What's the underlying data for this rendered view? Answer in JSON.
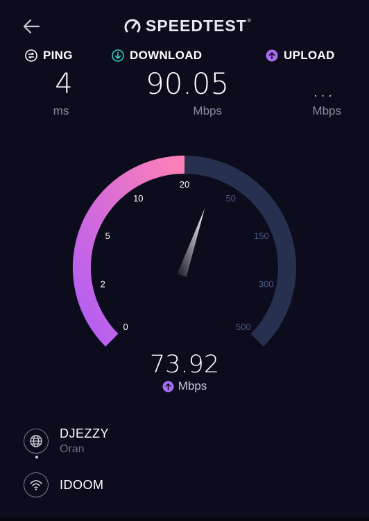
{
  "header": {
    "back_icon": "arrow-left-icon",
    "logo_icon": "speedometer-icon",
    "logo_text": "SPEEDTEST",
    "logo_tm": "®"
  },
  "metrics": {
    "ping": {
      "label": "PING",
      "value": "4",
      "unit": "ms",
      "icon": "ping-icon",
      "color": "#ffffff"
    },
    "download": {
      "label": "DOWNLOAD",
      "value": "90.05",
      "unit": "Mbps",
      "icon": "download-arrow-icon",
      "color": "#37d0c4"
    },
    "upload": {
      "label": "UPLOAD",
      "value": "...",
      "unit": "Mbps",
      "icon": "upload-arrow-icon",
      "color": "#a86cf0"
    }
  },
  "gauge": {
    "ticks": [
      "0",
      "2",
      "5",
      "10",
      "20",
      "50",
      "150",
      "300",
      "500"
    ],
    "current_value": 73.92,
    "filled_fraction": 0.5,
    "needle_fraction": 0.57,
    "colors": {
      "fill_start": "#b05cf5",
      "fill_end": "#ff80b6",
      "track": "#27314f",
      "needle": "#ffffff",
      "tick_active": "#ffffff",
      "tick_inactive": "#4a5a86"
    }
  },
  "result": {
    "value": "73.92",
    "unit": "Mbps",
    "icon": "upload-arrow-icon"
  },
  "provider": {
    "name": "DJEZZY",
    "location": "Oran",
    "icon": "globe-icon"
  },
  "connection": {
    "name": "IDOOM",
    "icon": "wifi-icon"
  }
}
